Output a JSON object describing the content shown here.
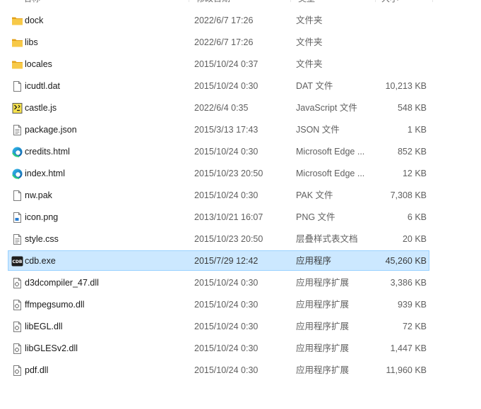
{
  "columns": {
    "name": "名称",
    "date": "修改日期",
    "type": "类型",
    "size": "大小"
  },
  "colors": {
    "selection_bg": "#cce8ff",
    "selection_border": "#99d1ff",
    "folder": "#f2c14e",
    "edge": "#1b8fd6"
  },
  "files": [
    {
      "name": "dock",
      "date": "2022/6/7 17:26",
      "type": "文件夹",
      "size": "",
      "icon": "folder-icon"
    },
    {
      "name": "libs",
      "date": "2022/6/7 17:26",
      "type": "文件夹",
      "size": "",
      "icon": "folder-icon"
    },
    {
      "name": "locales",
      "date": "2015/10/24 0:37",
      "type": "文件夹",
      "size": "",
      "icon": "folder-icon"
    },
    {
      "name": "icudtl.dat",
      "date": "2015/10/24 0:30",
      "type": "DAT 文件",
      "size": "10,213 KB",
      "icon": "file-icon"
    },
    {
      "name": "castle.js",
      "date": "2022/6/4 0:35",
      "type": "JavaScript 文件",
      "size": "548 KB",
      "icon": "js-file-icon"
    },
    {
      "name": "package.json",
      "date": "2015/3/13 17:43",
      "type": "JSON 文件",
      "size": "1 KB",
      "icon": "text-file-icon"
    },
    {
      "name": "credits.html",
      "date": "2015/10/24 0:30",
      "type": "Microsoft Edge ...",
      "size": "852 KB",
      "icon": "edge-icon"
    },
    {
      "name": "index.html",
      "date": "2015/10/23 20:50",
      "type": "Microsoft Edge ...",
      "size": "12 KB",
      "icon": "edge-icon"
    },
    {
      "name": "nw.pak",
      "date": "2015/10/24 0:30",
      "type": "PAK 文件",
      "size": "7,308 KB",
      "icon": "file-icon"
    },
    {
      "name": "icon.png",
      "date": "2013/10/21 16:07",
      "type": "PNG 文件",
      "size": "6 KB",
      "icon": "image-file-icon"
    },
    {
      "name": "style.css",
      "date": "2015/10/23 20:50",
      "type": "层叠样式表文档",
      "size": "20 KB",
      "icon": "text-file-icon"
    },
    {
      "name": "cdb.exe",
      "date": "2015/7/29 12:42",
      "type": "应用程序",
      "size": "45,260 KB",
      "icon": "cdb-app-icon",
      "selected": true,
      "icon_text": "CDB"
    },
    {
      "name": "d3dcompiler_47.dll",
      "date": "2015/10/24 0:30",
      "type": "应用程序扩展",
      "size": "3,386 KB",
      "icon": "dll-file-icon"
    },
    {
      "name": "ffmpegsumo.dll",
      "date": "2015/10/24 0:30",
      "type": "应用程序扩展",
      "size": "939 KB",
      "icon": "dll-file-icon"
    },
    {
      "name": "libEGL.dll",
      "date": "2015/10/24 0:30",
      "type": "应用程序扩展",
      "size": "72 KB",
      "icon": "dll-file-icon"
    },
    {
      "name": "libGLESv2.dll",
      "date": "2015/10/24 0:30",
      "type": "应用程序扩展",
      "size": "1,447 KB",
      "icon": "dll-file-icon"
    },
    {
      "name": "pdf.dll",
      "date": "2015/10/24 0:30",
      "type": "应用程序扩展",
      "size": "11,960 KB",
      "icon": "dll-file-icon"
    }
  ]
}
